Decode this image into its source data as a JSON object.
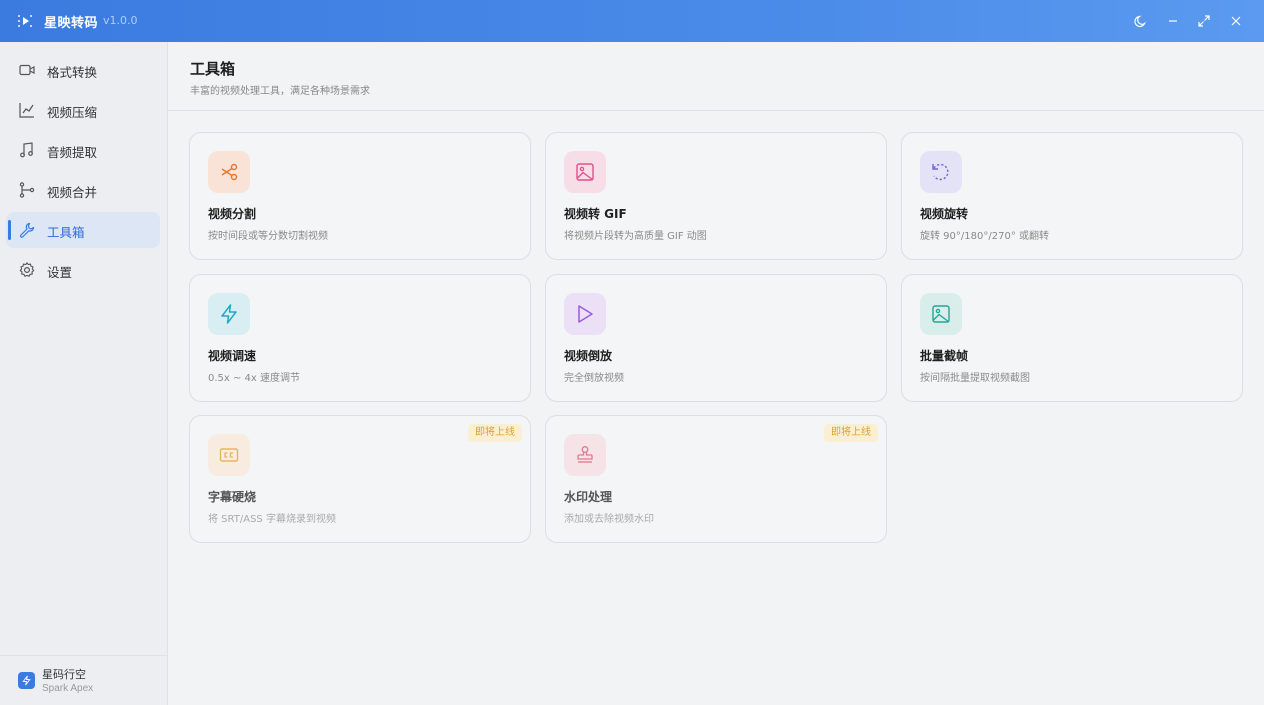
{
  "app": {
    "name": "星映转码",
    "version": "v1.0.0"
  },
  "sidebar": {
    "items": [
      {
        "label": "格式转换",
        "icon": "video-camera-icon"
      },
      {
        "label": "视频压缩",
        "icon": "compress-icon"
      },
      {
        "label": "音频提取",
        "icon": "music-note-icon"
      },
      {
        "label": "视频合并",
        "icon": "merge-icon"
      },
      {
        "label": "工具箱",
        "icon": "wrench-icon",
        "active": true
      },
      {
        "label": "设置",
        "icon": "gear-icon"
      }
    ],
    "footer": {
      "name": "星码行空",
      "sub": "Spark Apex"
    }
  },
  "page": {
    "title": "工具箱",
    "subtitle": "丰富的视频处理工具，满足各种场景需求"
  },
  "tools": [
    {
      "title": "视频分割",
      "desc": "按时间段或等分数切割视频",
      "icon": "scissors-icon",
      "color": "#e8772e"
    },
    {
      "title": "视频转 GIF",
      "desc": "将视频片段转为高质量 GIF 动图",
      "icon": "image-icon",
      "color": "#e0508a"
    },
    {
      "title": "视频旋转",
      "desc": "旋转 90°/180°/270° 或翻转",
      "icon": "rotate-icon",
      "color": "#6b63d9"
    },
    {
      "title": "视频调速",
      "desc": "0.5x ~ 4x 速度调节",
      "icon": "lightning-icon",
      "color": "#1fa9c4"
    },
    {
      "title": "视频倒放",
      "desc": "完全倒放视频",
      "icon": "play-icon",
      "color": "#9b5ae0"
    },
    {
      "title": "批量截帧",
      "desc": "按间隔批量提取视频截图",
      "icon": "image-icon",
      "color": "#1fa697"
    },
    {
      "title": "字幕硬烧",
      "desc": "将 SRT/ASS 字幕烧录到视频",
      "icon": "cc-icon",
      "color": "#e0a030",
      "badge": "即将上线"
    },
    {
      "title": "水印处理",
      "desc": "添加或去除视频水印",
      "icon": "stamp-icon",
      "color": "#e0506a",
      "badge": "即将上线"
    }
  ]
}
